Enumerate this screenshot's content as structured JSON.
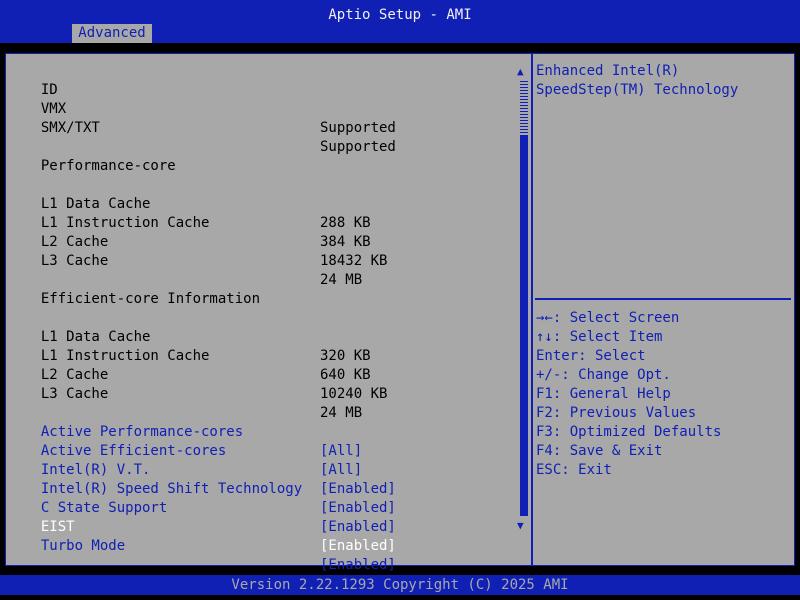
{
  "header": {
    "title": "Aptio Setup - AMI",
    "tab": "Advanced"
  },
  "settings": [
    {
      "label": "ID",
      "value": ""
    },
    {
      "label": "VMX",
      "value": "Supported"
    },
    {
      "label": "SMX/TXT",
      "value": "Supported"
    },
    {
      "label": "Performance-core",
      "value": ""
    },
    {
      "label": "L1 Data Cache",
      "value": "288 KB"
    },
    {
      "label": "L1 Instruction Cache",
      "value": "384 KB"
    },
    {
      "label": "L2 Cache",
      "value": "18432 KB"
    },
    {
      "label": "L3 Cache",
      "value": "24 MB"
    },
    {
      "label": "Efficient-core Information",
      "value": ""
    },
    {
      "label": "L1 Data Cache",
      "value": "320 KB"
    },
    {
      "label": "L1 Instruction Cache",
      "value": "640 KB"
    },
    {
      "label": "L2 Cache",
      "value": "10240 KB"
    },
    {
      "label": "L3 Cache",
      "value": "24 MB"
    },
    {
      "label": "Active Performance-cores",
      "value": "[All]"
    },
    {
      "label": "Active Efficient-cores",
      "value": "[All]"
    },
    {
      "label": "Intel(R) V.T.",
      "value": "[Enabled]"
    },
    {
      "label": "Intel(R) Speed Shift Technology",
      "value": "[Enabled]"
    },
    {
      "label": "C State Support",
      "value": "[Enabled]"
    },
    {
      "label": "EIST",
      "value": "[Enabled]"
    },
    {
      "label": "Turbo Mode",
      "value": "[Enabled]"
    }
  ],
  "help": {
    "line1": "Enhanced Intel(R)",
    "line2": "SpeedStep(TM) Technology"
  },
  "keys": [
    "→←: Select Screen",
    "↑↓: Select Item",
    "Enter: Select",
    "+/-: Change Opt.",
    "F1: General Help",
    "F2: Previous Values",
    "F3: Optimized Defaults",
    "F4: Save & Exit",
    "ESC: Exit"
  ],
  "footer": {
    "version": "Version 2.22.1293 Copyright (C) 2025 AMI"
  },
  "colors": {
    "blue": "#1020b4",
    "gray": "#a8a8a8",
    "white": "#ffffff"
  },
  "icons": {
    "scroll_up": "triangle-up",
    "scroll_down": "triangle-down"
  }
}
